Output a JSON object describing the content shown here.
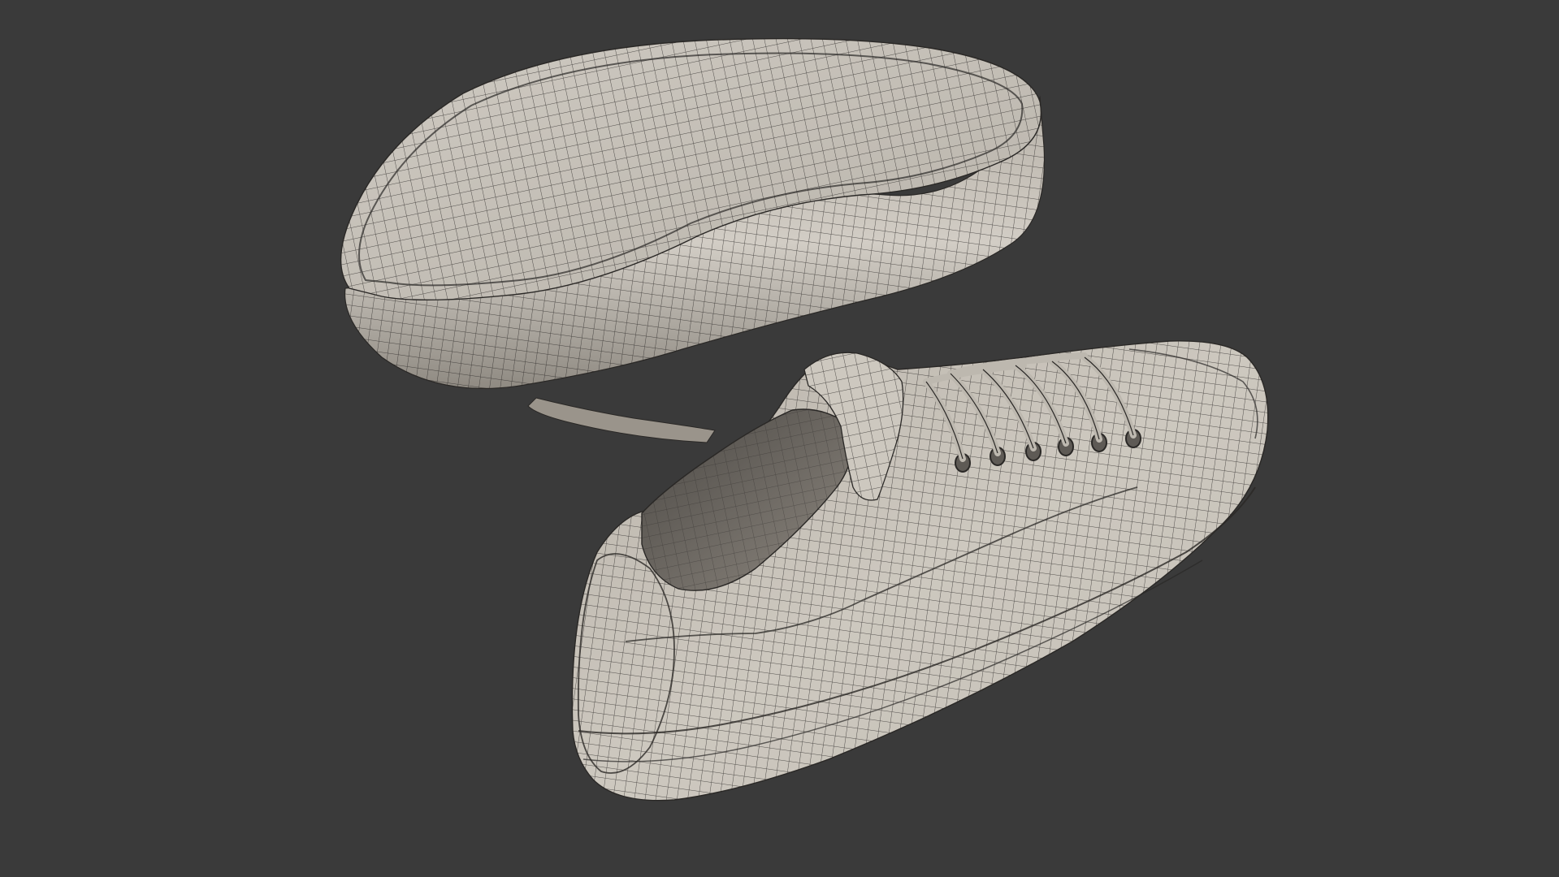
{
  "viewport": {
    "background_color": "#3a3a3a"
  },
  "render": {
    "mesh_color": "#c9c4bb",
    "mesh_shadow_color": "#7f7a72",
    "wire_color": "#2a2826",
    "objects": [
      "sneaker-upside-down",
      "sneaker-upright"
    ]
  }
}
